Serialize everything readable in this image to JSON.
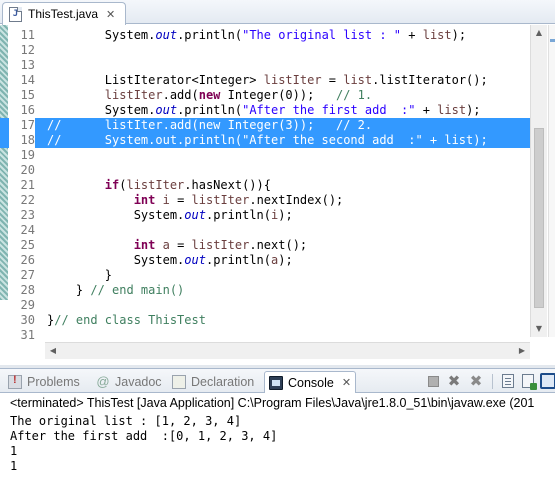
{
  "editor": {
    "tab_title": "ThisTest.java",
    "lines": [
      {
        "n": "11",
        "text": "        System.out.println(\"The original list : \" + list);"
      },
      {
        "n": "12",
        "text": ""
      },
      {
        "n": "13",
        "text": ""
      },
      {
        "n": "14",
        "text": "        ListIterator<Integer> listIter = list.listIterator();"
      },
      {
        "n": "15",
        "text": "        listIter.add(new Integer(0));   // 1."
      },
      {
        "n": "16",
        "text": "        System.out.println(\"After the first add  :\" + list);"
      },
      {
        "n": "17",
        "text": "//      listIter.add(new Integer(3));   // 2."
      },
      {
        "n": "18",
        "text": "//      System.out.println(\"After the second add  :\" + list);"
      },
      {
        "n": "19",
        "text": ""
      },
      {
        "n": "20",
        "text": ""
      },
      {
        "n": "21",
        "text": "        if(listIter.hasNext()){"
      },
      {
        "n": "22",
        "text": "            int i = listIter.nextIndex();"
      },
      {
        "n": "23",
        "text": "            System.out.println(i);"
      },
      {
        "n": "24",
        "text": ""
      },
      {
        "n": "25",
        "text": "            int a = listIter.next();"
      },
      {
        "n": "26",
        "text": "            System.out.println(a);"
      },
      {
        "n": "27",
        "text": "        }"
      },
      {
        "n": "28",
        "text": "    } // end main()"
      },
      {
        "n": "29",
        "text": ""
      },
      {
        "n": "30",
        "text": "}// end class ThisTest"
      },
      {
        "n": "31",
        "text": ""
      }
    ],
    "selected_line_numbers": [
      "17",
      "18"
    ]
  },
  "views": {
    "tabs": [
      {
        "label": "Problems",
        "icon": "problems-icon"
      },
      {
        "label": "Javadoc",
        "icon": "javadoc-icon"
      },
      {
        "label": "Declaration",
        "icon": "declaration-icon"
      },
      {
        "label": "Console",
        "icon": "console-icon",
        "active": true
      }
    ]
  },
  "console": {
    "terminated_label": "<terminated> ThisTest [Java Application] C:\\Program Files\\Java\\jre1.8.0_51\\bin\\javaw.exe (201",
    "output": [
      "The original list : [1, 2, 3, 4]",
      "After the first add  :[0, 1, 2, 3, 4]",
      "1",
      "1"
    ]
  },
  "colors": {
    "selection": "#3399ff",
    "keyword": "#7f0055",
    "string": "#2a00ff",
    "comment": "#3f7f5f",
    "field": "#0000c0"
  }
}
